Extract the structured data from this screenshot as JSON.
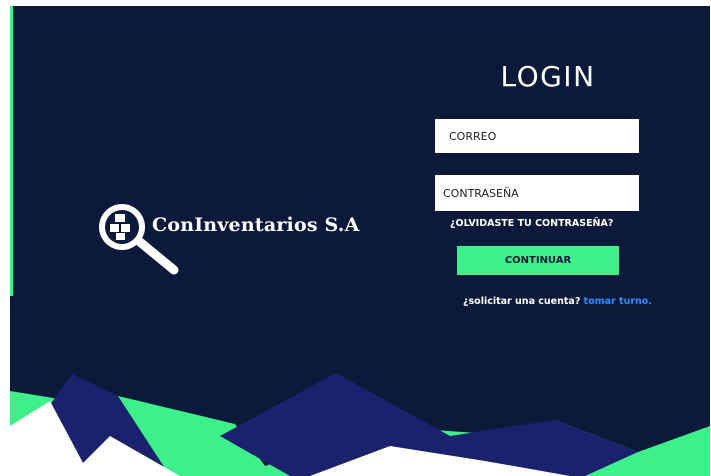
{
  "login": {
    "title": "LOGIN",
    "email_placeholder": "CORREO",
    "password_placeholder": "CONTRASEÑA",
    "forgot_password": "¿OLVIDASTE TU CONTRASEÑA?",
    "continue_label": "CONTINUAR",
    "signup_prompt": "¿solicitar una cuenta?",
    "signup_link": "tomar turno."
  },
  "branding": {
    "company_name": "ConInventarios S.A",
    "logo_icon": "magnifier-boxes-icon"
  },
  "colors": {
    "background": "#0b1a3a",
    "accent_green": "#3ef08a",
    "link_blue": "#2f8dff",
    "wave_indigo": "#1a226e"
  }
}
